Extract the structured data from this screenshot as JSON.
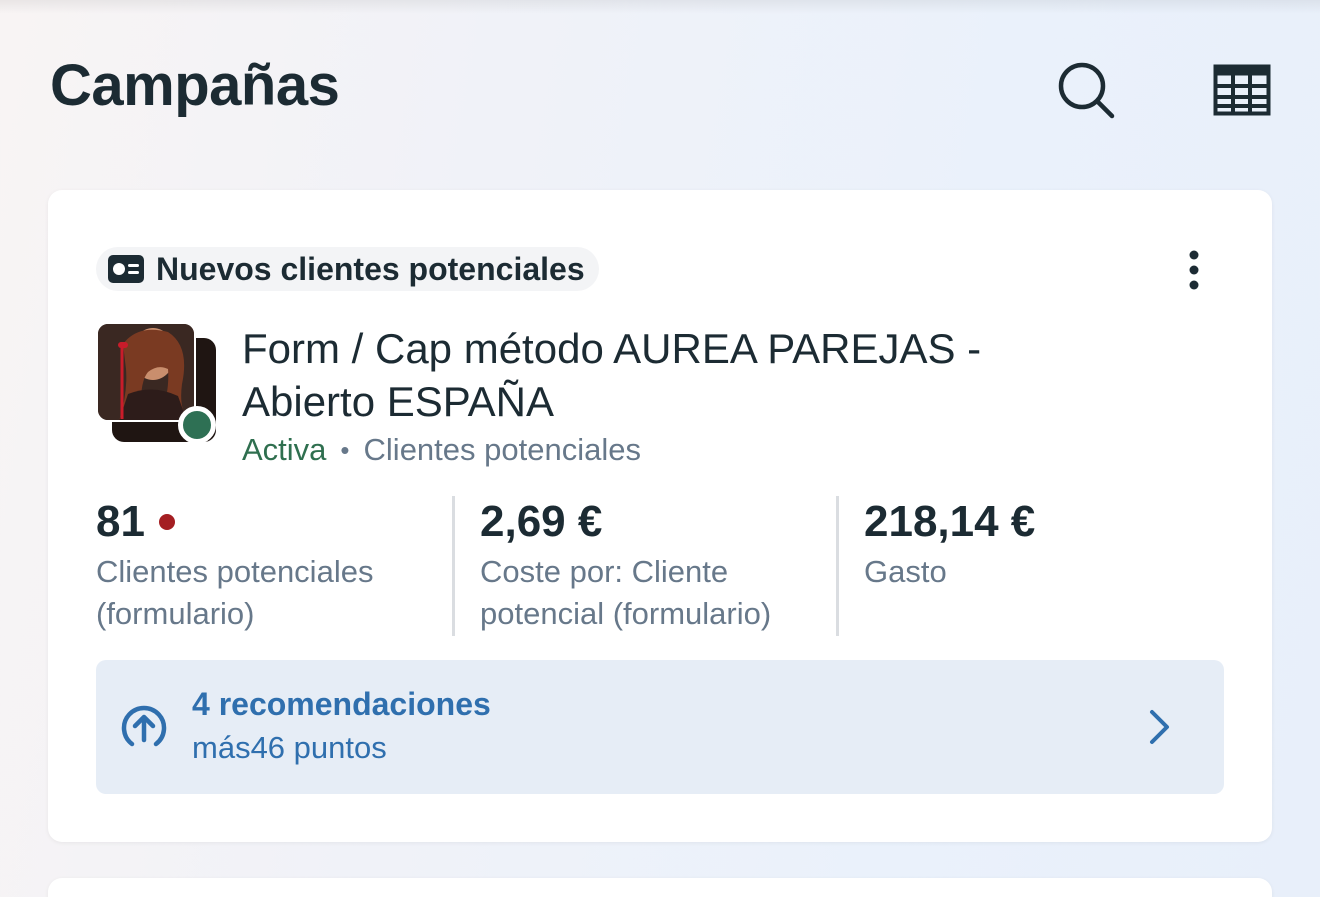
{
  "header": {
    "title": "Campañas",
    "search_icon": "search-icon",
    "table_icon": "table-grid-icon"
  },
  "campaign_card": {
    "objective_label": "Nuevos clientes potenciales",
    "objective_icon": "lead-card-icon",
    "more_icon": "more-vertical-icon",
    "name": "Form / Cap método AUREA PAREJAS  - Abierto ESPAÑA",
    "status": "Activa",
    "separator": "•",
    "type": "Clientes potenciales",
    "status_color": "#2e7054",
    "metrics": [
      {
        "value": "81",
        "label": "Clientes potenciales (formulario)",
        "alert": true,
        "alert_color": "#a41e22"
      },
      {
        "value": "2,69 €",
        "label": "Coste por: Cliente potencial (formulario)"
      },
      {
        "value": "218,14 €",
        "label": "Gasto"
      }
    ],
    "recommendations": {
      "title": "4 recomendaciones",
      "subtitle": "más46 puntos",
      "icon": "arrow-up-circle-icon",
      "chevron_icon": "chevron-right-icon",
      "accent": "#2f6fae"
    }
  }
}
